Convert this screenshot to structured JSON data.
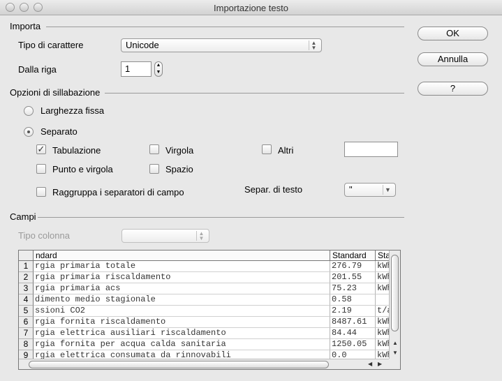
{
  "window": {
    "title": "Importazione testo"
  },
  "buttons": {
    "ok": "OK",
    "cancel": "Annulla",
    "help": "?"
  },
  "import": {
    "section": "Importa",
    "charset_label": "Tipo di carattere",
    "charset_value": "Unicode",
    "from_row_label": "Dalla riga",
    "from_row_value": "1"
  },
  "separator": {
    "section": "Opzioni di sillabazione",
    "fixed_width": "Larghezza fissa",
    "separated": "Separato",
    "tab": "Tabulazione",
    "comma": "Virgola",
    "other": "Altri",
    "semicolon": "Punto e virgola",
    "space": "Spazio",
    "merge": "Raggruppa i separatori di campo",
    "text_delim_label": "Separ. di testo",
    "text_delim_value": "\"",
    "selected_mode": "Separato",
    "checked": [
      "Tabulazione"
    ]
  },
  "fields": {
    "section": "Campi",
    "column_type_label": "Tipo colonna",
    "column_type_value": ""
  },
  "grid": {
    "headers": [
      "ndard",
      "Standard",
      "Sta"
    ],
    "rows": [
      {
        "n": "1",
        "a": "rgia primaria totale",
        "b": "276.79",
        "c": "kWh"
      },
      {
        "n": "2",
        "a": "rgia primaria riscaldamento",
        "b": "201.55",
        "c": "kWh"
      },
      {
        "n": "3",
        "a": "rgia primaria acs",
        "b": "75.23",
        "c": "kWh"
      },
      {
        "n": "4",
        "a": "dimento medio stagionale",
        "b": "0.58",
        "c": ""
      },
      {
        "n": "5",
        "a": "ssioni CO2",
        "b": "2.19",
        "c": "t/a"
      },
      {
        "n": "6",
        "a": "rgia fornita riscaldamento",
        "b": "8487.61",
        "c": "kWh"
      },
      {
        "n": "7",
        "a": "rgia elettrica ausiliari riscaldamento",
        "b": "84.44",
        "c": "kWh"
      },
      {
        "n": "8",
        "a": "rgia fornita per acqua calda sanitaria",
        "b": "1250.05",
        "c": "kWh"
      },
      {
        "n": "9",
        "a": "rgia elettrica consumata da rinnovabili",
        "b": "0.0",
        "c": "kWh"
      }
    ]
  }
}
